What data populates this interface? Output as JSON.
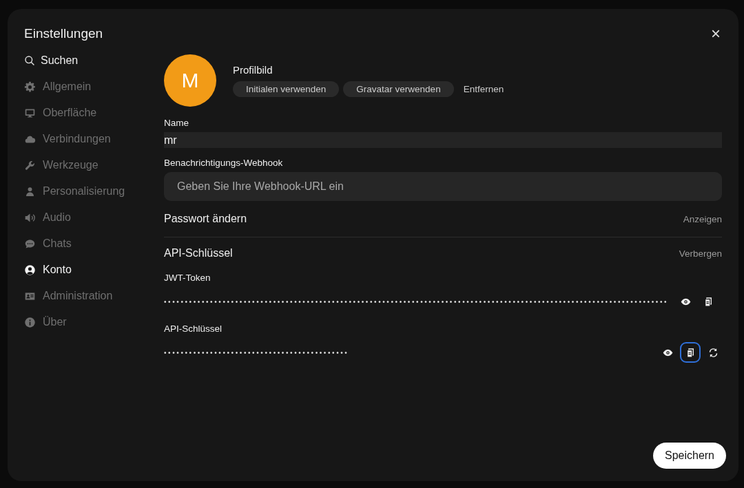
{
  "dialog": {
    "title": "Einstellungen",
    "close": "×"
  },
  "search": {
    "placeholder": "Suchen"
  },
  "sidebar": {
    "items": [
      {
        "label": "Allgemein",
        "selected": false
      },
      {
        "label": "Oberfläche",
        "selected": false
      },
      {
        "label": "Verbindungen",
        "selected": false
      },
      {
        "label": "Werkzeuge",
        "selected": false
      },
      {
        "label": "Personalisierung",
        "selected": false
      },
      {
        "label": "Audio",
        "selected": false
      },
      {
        "label": "Chats",
        "selected": false
      },
      {
        "label": "Konto",
        "selected": true
      },
      {
        "label": "Administration",
        "selected": false
      },
      {
        "label": "Über",
        "selected": false
      }
    ]
  },
  "profile": {
    "avatar_initial": "M",
    "title": "Profilbild",
    "buttons": [
      "Initialen verwenden",
      "Gravatar verwenden"
    ],
    "remove": "Entfernen"
  },
  "name_field": {
    "label": "Name",
    "value": "mr"
  },
  "webhook_field": {
    "label": "Benachrichtigungs-Webhook",
    "placeholder": "Geben Sie Ihre Webhook-URL ein"
  },
  "password": {
    "title": "Passwort ändern",
    "toggle": "Anzeigen"
  },
  "api_keys": {
    "title": "API-Schlüssel",
    "toggle": "Verbergen",
    "keys": [
      {
        "label": "JWT-Token",
        "value": "••••••••••••••••••••••••••••••••••••••••••••••••••••••••••••••••••••••••••••••••••••••••••••••••••••••••••••••••••••••••",
        "regenerate": false,
        "copy_focused": false
      },
      {
        "label": "API-Schlüssel",
        "value": "••••••••••••••••••••••••••••••••••••••••••••",
        "regenerate": true,
        "copy_focused": true
      }
    ]
  },
  "save_button": "Speichern"
}
